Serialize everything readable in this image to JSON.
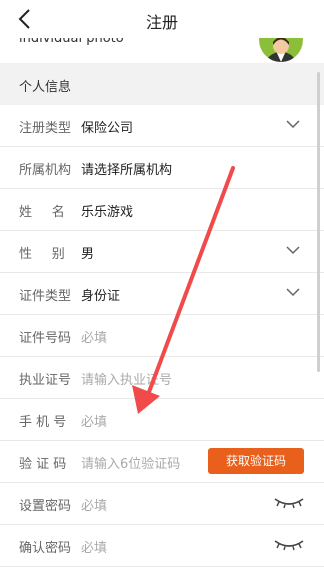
{
  "header": {
    "title": "注册"
  },
  "avatar_row": {
    "label": "individual photo"
  },
  "section": {
    "title": "个人信息"
  },
  "form": {
    "rows": [
      {
        "label": "注册类型",
        "value": "保险公司",
        "placeholder": "",
        "accessory": "chevron-down"
      },
      {
        "label": "所属机构",
        "value": "请选择所属机构",
        "placeholder": "",
        "accessory": ""
      },
      {
        "label": "姓 名",
        "value": "乐乐游戏",
        "placeholder": "",
        "accessory": ""
      },
      {
        "label": "性 别",
        "value": "男",
        "placeholder": "",
        "accessory": "chevron-down"
      },
      {
        "label": "证件类型",
        "value": "身份证",
        "placeholder": "",
        "accessory": "chevron-down"
      },
      {
        "label": "证件号码",
        "value": "",
        "placeholder": "必填",
        "accessory": ""
      },
      {
        "label": "执业证号",
        "value": "",
        "placeholder": "请输入执业证号",
        "accessory": ""
      },
      {
        "label": "手 机 号",
        "value": "",
        "placeholder": "必填",
        "accessory": ""
      },
      {
        "label": "验 证 码",
        "value": "",
        "placeholder": "请输入6位验证码",
        "accessory": "button"
      },
      {
        "label": "设置密码",
        "value": "",
        "placeholder": "必填",
        "accessory": "eye-closed"
      },
      {
        "label": "确认密码",
        "value": "",
        "placeholder": "必填",
        "accessory": "eye-closed"
      }
    ],
    "get_code_label": "获取验证码"
  },
  "colors": {
    "accent": "#e8601c",
    "arrow": "#f04a4a"
  }
}
